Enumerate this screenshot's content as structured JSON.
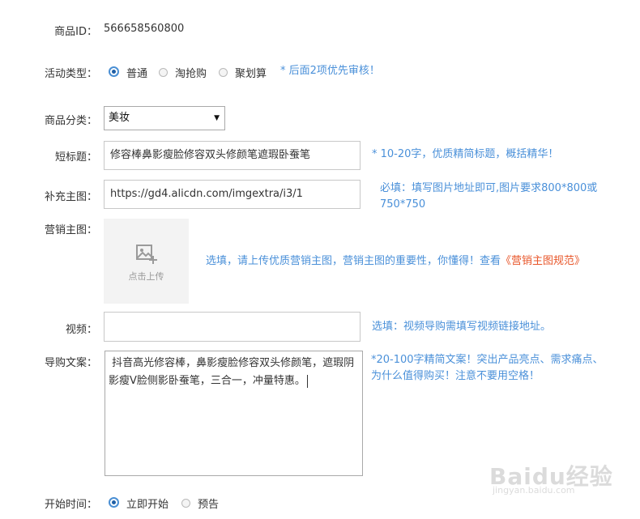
{
  "product_id": {
    "label": "商品ID：",
    "value": "566658560800"
  },
  "activity_type": {
    "label": "活动类型：",
    "options": [
      "普通",
      "淘抢购",
      "聚划算"
    ],
    "selected": "普通",
    "hint": "* 后面2项优先审核！"
  },
  "category": {
    "label": "商品分类：",
    "value": "美妆"
  },
  "short_title": {
    "label": "短标题：",
    "value": "修容棒鼻影瘦脸修容双头修颜笔遮瑕卧蚕笔",
    "hint": "* 10-20字，优质精简标题，概括精华！"
  },
  "extra_image": {
    "label": "补充主图：",
    "value": "https://gd4.alicdn.com/imgextra/i3/1",
    "hint": "必填：填写图片地址即可,图片要求800*800或750*750"
  },
  "marketing_image": {
    "label": "营销主图：",
    "upload_label": "点击上传",
    "hint": "选填，请上传优质营销主图，营销主图的重要性，你懂得！查看",
    "hint_link": "《营销主图规范》"
  },
  "video": {
    "label": "视频：",
    "value": "",
    "hint": "选填：视频导购需填写视频链接地址。"
  },
  "guide_copy": {
    "label": "导购文案：",
    "value": " 抖音高光修容棒，鼻影瘦脸修容双头修颜笔，遮瑕阴影瘦V脸侧影卧蚕笔，三合一，冲量特惠。",
    "hint": "*20-100字精简文案！突出产品亮点、需求痛点、为什么值得购买！注意不要用空格！"
  },
  "start_time": {
    "label": "开始时间：",
    "options": [
      "立即开始",
      "预告"
    ],
    "selected": "立即开始"
  },
  "watermark": {
    "main": "Baidu经验",
    "sub": "jingyan.baidu.com"
  }
}
